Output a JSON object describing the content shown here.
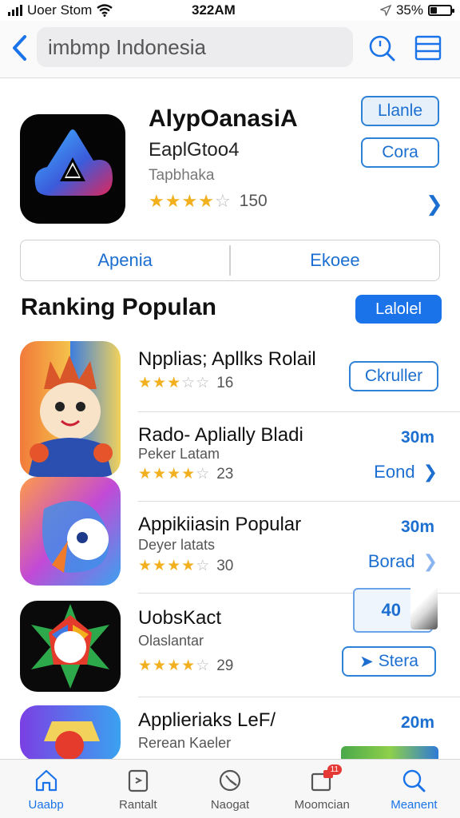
{
  "status_bar": {
    "carrier": "Uoer Stom",
    "time": "322AM",
    "battery": "35%",
    "battery_level": 0.35
  },
  "search": {
    "query": "imbmp Indonesia"
  },
  "featured": {
    "title": "AlypOanasiA",
    "subtitle": "EaplGtoo4",
    "category": "Tapbhaka",
    "stars": 4,
    "rating_count": "150",
    "primary_button": "Llanle",
    "secondary_button": "Cora"
  },
  "segment": {
    "left": "Apenia",
    "right": "Ekoee"
  },
  "section": {
    "title": "Ranking Populan",
    "button": "Lalolel"
  },
  "apps": [
    {
      "title": "Npplias; Apllks Rolail",
      "stars": 3,
      "rating_count": "16",
      "button": "Ckruller"
    },
    {
      "title": "Rado- Aplially Bladi",
      "subtitle": "Peker Latam",
      "stars": 4,
      "rating_count": "23",
      "size": "30m",
      "link": "Eond"
    },
    {
      "title": "Appikiiasin Popular",
      "subtitle": "Deyer latats",
      "stars": 4,
      "rating_count": "30",
      "size": "30m",
      "link": "Borad"
    },
    {
      "title": "UobsKact",
      "subtitle": "Olaslantar",
      "stars": 4,
      "rating_count": "29",
      "box_value": "40",
      "button": "Stera"
    },
    {
      "title": "Applieriaks LeF/",
      "subtitle": "Rerean Kaeler",
      "size": "20m"
    }
  ],
  "tabs": [
    {
      "label": "Uaabp",
      "icon": "home-icon",
      "active": true
    },
    {
      "label": "Rantalt",
      "icon": "ranking-icon",
      "active": false
    },
    {
      "label": "Naogat",
      "icon": "clock-icon",
      "active": false
    },
    {
      "label": "Moomcian",
      "icon": "updates-icon",
      "active": false,
      "badge": "11"
    },
    {
      "label": "Meanent",
      "icon": "search-icon",
      "active": true
    }
  ],
  "colors": {
    "accent": "#1a73e8",
    "star": "#f2b01e"
  }
}
